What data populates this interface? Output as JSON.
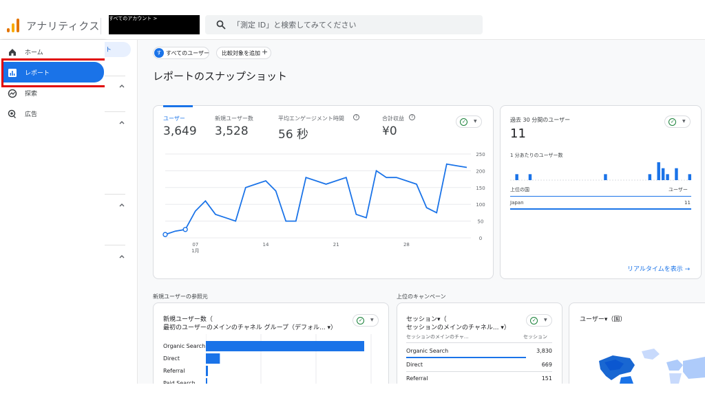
{
  "header": {
    "app_title": "アナリティクス",
    "account_label": "すべてのアカウント >",
    "search_placeholder": "「測定 ID」と検索してみてください"
  },
  "nav": {
    "items": [
      {
        "label": "ホーム",
        "icon": "home-icon"
      },
      {
        "label": "レポート",
        "icon": "reports-icon",
        "active": true
      },
      {
        "label": "探索",
        "icon": "explore-icon"
      },
      {
        "label": "広告",
        "icon": "advertising-icon"
      }
    ],
    "side_chip": "ト"
  },
  "filters": {
    "all_users_icon": "す",
    "all_users": "すべてのユーザー",
    "add_compare": "比較対象を追加"
  },
  "page_title": "レポートのスナップショット",
  "metrics": [
    {
      "label": "ユーザー",
      "value": "3,649"
    },
    {
      "label": "新規ユーザー数",
      "value": "3,528"
    },
    {
      "label": "平均エンゲージメント時間",
      "value": "56 秒"
    },
    {
      "label": "合計収益",
      "value": "¥0"
    }
  ],
  "chart_data": {
    "type": "line",
    "x_ticks": [
      {
        "label": "07",
        "sub": "1月",
        "index": 7
      },
      {
        "label": "14",
        "index": 14
      },
      {
        "label": "21",
        "index": 21
      },
      {
        "label": "28",
        "index": 28
      }
    ],
    "y_ticks": [
      0,
      50,
      100,
      150,
      200,
      250
    ],
    "ylim": [
      0,
      250
    ],
    "series": [
      {
        "values": [
          10,
          20,
          25,
          80,
          110,
          70,
          60,
          50,
          150,
          160,
          170,
          140,
          50,
          50,
          180,
          170,
          160,
          170,
          180,
          70,
          60,
          200,
          180,
          180,
          170,
          160,
          90,
          75,
          220,
          215,
          210
        ]
      }
    ],
    "open_points": [
      0,
      2
    ],
    "color": "#1a73e8"
  },
  "realtime": {
    "title": "過去 30 分間のユーザー",
    "value": "11",
    "per_minute_label": "1 分あたりのユーザー数",
    "bars": [
      0,
      1,
      0,
      0,
      1,
      0,
      0,
      0,
      0,
      0,
      0,
      0,
      0,
      0,
      0,
      0,
      0,
      0,
      0,
      0,
      0,
      1,
      0,
      0,
      0,
      0,
      0,
      0,
      0,
      0,
      0,
      1,
      0,
      3,
      2,
      1,
      0,
      2,
      0,
      0,
      1
    ],
    "col_country": "上位の国",
    "col_users": "ユーザー",
    "row_country": "Japan",
    "row_users": "11",
    "link": "リアルタイムを表示 →"
  },
  "new_users_section": {
    "label": "新規ユーザーの参照元",
    "title_line1": "新規ユーザー数（",
    "title_line2": "最初のユーザーのメインのチャネル グループ（デフォル... ▾）",
    "rows": [
      {
        "label": "Organic Search",
        "value": 3050
      },
      {
        "label": "Direct",
        "value": 270
      },
      {
        "label": "Referral",
        "value": 40
      },
      {
        "label": "Paid Search",
        "value": 10
      }
    ],
    "max": 3050
  },
  "campaign_section": {
    "label": "上位のキャンペーン",
    "title_line1": "セッション▾（",
    "title_line2": "セッションのメインのチャネル... ▾）",
    "col_left": "セッションのメインのチャ...",
    "col_right": "セッション",
    "rows": [
      {
        "label": "Organic Search",
        "value": "3,830"
      },
      {
        "label": "Direct",
        "value": "669"
      },
      {
        "label": "Referral",
        "value": "151"
      }
    ]
  },
  "country_section": {
    "title": "ユーザー▾（国）"
  }
}
